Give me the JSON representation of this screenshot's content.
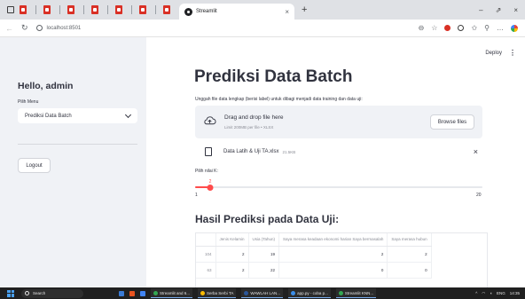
{
  "browser": {
    "tab_title": "Streamlit",
    "tab_close": "×",
    "new_tab": "+",
    "url": "localhost:8501",
    "win_controls": [
      "–",
      "⇗",
      "×"
    ]
  },
  "sidebar": {
    "greeting": "Hello, admin",
    "menu_label": "Pilih Menu",
    "menu_selected": "Prediksi Data Batch",
    "logout_label": "Logout"
  },
  "header": {
    "deploy_label": "Deploy",
    "menu_glyph": "⋮"
  },
  "main": {
    "title": "Prediksi Data Batch",
    "upload_label": "Unggah file data lengkap (berisi label) untuk dibagi menjadi data training dan data uji:",
    "dropzone_title": "Drag and drop file here",
    "dropzone_limit": "Limit 200MB per file • XLSX",
    "browse_label": "Browse files",
    "file_name": "Data Latih & Uji TA.xlsx",
    "file_size": "21.5KB",
    "file_close": "×",
    "k_label": "Pilih nilai K:",
    "k_value": 2,
    "k_value_text": "2",
    "k_min": "1",
    "k_max": "20",
    "result_title": "Hasil Prediksi pada Data Uji:"
  },
  "table": {
    "headers": [
      "",
      "Jenis Kelamin",
      "Usia (Tahun)",
      "Saya merasa keadaan ekonomi harian Saya bermasalah",
      "Saya merasa hubun"
    ],
    "rows": [
      [
        "104",
        "2",
        "19",
        "2",
        "2"
      ],
      [
        "63",
        "2",
        "22",
        "0",
        "0"
      ]
    ]
  },
  "taskbar": {
    "search_placeholder": "Search",
    "items": [
      "Streamlit and 6...",
      "Serba Serbi TA",
      "WAWLAH LAN...",
      "app.py - coba p...",
      "Streamlit KNN..."
    ],
    "tray_lang": "ENG",
    "tray_time": "14:35"
  },
  "colors": {
    "accent": "#ff4b4b",
    "sidebar_bg": "#f0f2f6",
    "text": "#31333f"
  }
}
